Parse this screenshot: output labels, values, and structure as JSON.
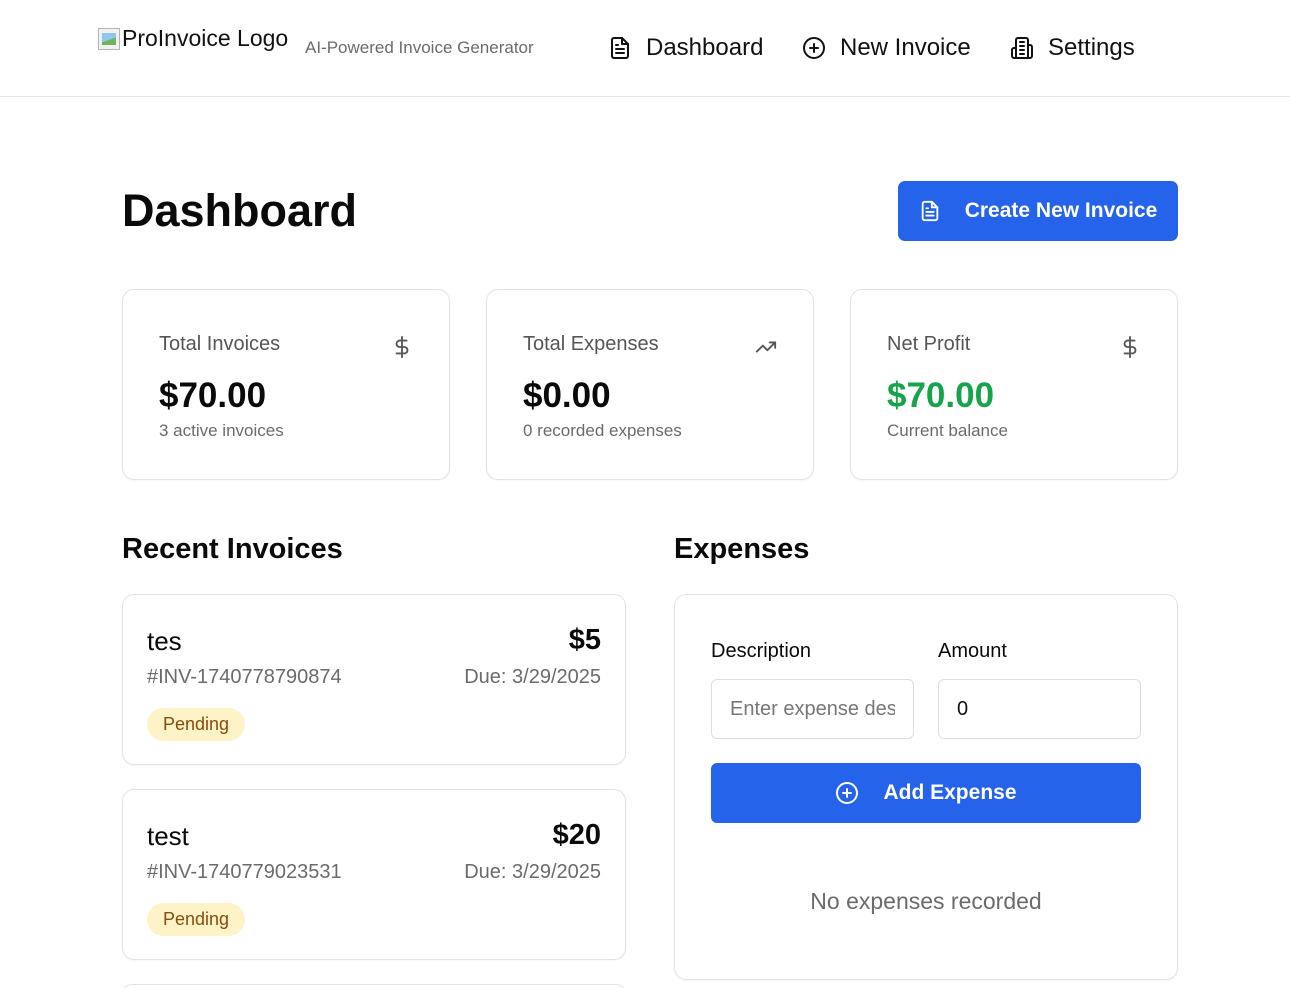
{
  "header": {
    "logo_alt": "ProInvoice Logo",
    "tagline": "AI-Powered Invoice Generator",
    "nav": [
      {
        "label": "Dashboard",
        "icon": "document-icon"
      },
      {
        "label": "New Invoice",
        "icon": "plus-circle-icon"
      },
      {
        "label": "Settings",
        "icon": "building-icon"
      }
    ]
  },
  "page": {
    "title": "Dashboard",
    "create_button": "Create New Invoice"
  },
  "stats": [
    {
      "label": "Total Invoices",
      "value": "$70.00",
      "sub": "3 active invoices",
      "icon": "dollar-icon"
    },
    {
      "label": "Total Expenses",
      "value": "$0.00",
      "sub": "0 recorded expenses",
      "icon": "trending-up-icon"
    },
    {
      "label": "Net Profit",
      "value": "$70.00",
      "sub": "Current balance",
      "icon": "dollar-icon"
    }
  ],
  "recent_invoices": {
    "title": "Recent Invoices",
    "items": [
      {
        "name": "tes",
        "number": "#INV-1740778790874",
        "amount": "$5",
        "due": "Due: 3/29/2025",
        "status": "Pending"
      },
      {
        "name": "test",
        "number": "#INV-1740779023531",
        "amount": "$20",
        "due": "Due: 3/29/2025",
        "status": "Pending"
      }
    ]
  },
  "expenses": {
    "title": "Expenses",
    "description_label": "Description",
    "description_placeholder": "Enter expense des",
    "amount_label": "Amount",
    "amount_value": "0",
    "add_button": "Add Expense",
    "empty_text": "No expenses recorded"
  },
  "colors": {
    "primary": "#2563eb",
    "profit_green": "#16a34a",
    "pending_bg": "#fef3c7",
    "pending_text": "#854d0e"
  }
}
